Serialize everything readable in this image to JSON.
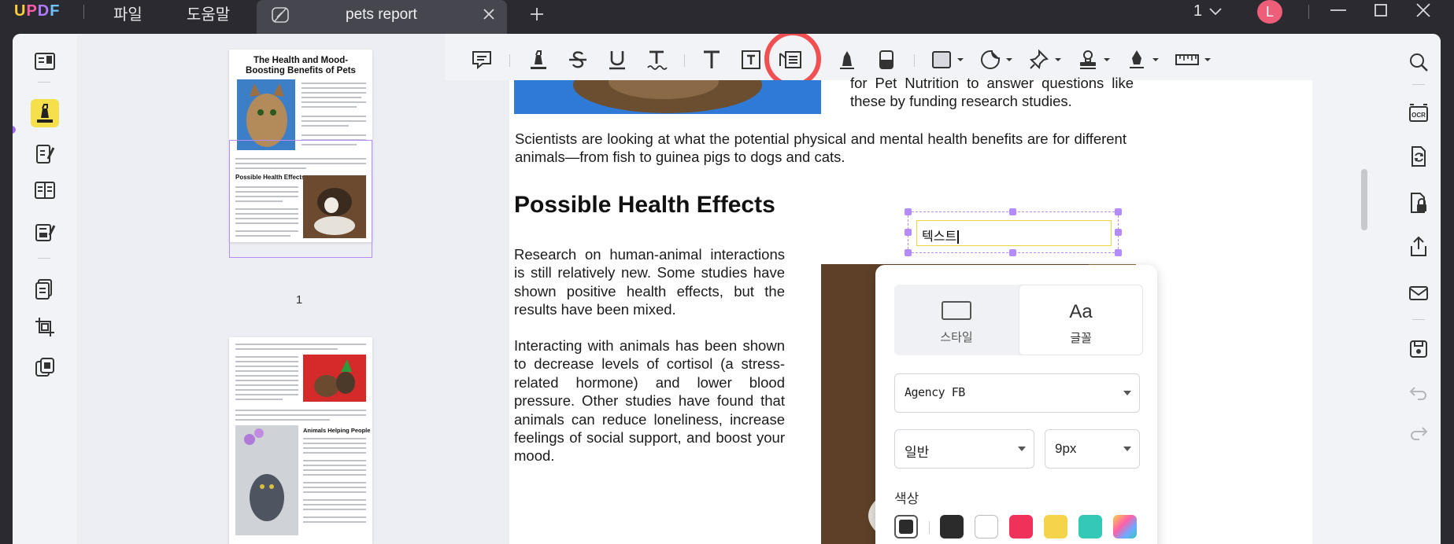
{
  "app": {
    "logo": "UPDF",
    "menu_file": "파일",
    "menu_help": "도움말",
    "tab_title": "pets report",
    "page_counter": "1",
    "avatar_initial": "L"
  },
  "thumbnails": {
    "page1_title": "The Health and Mood-Boosting Benefits of Pets",
    "page1_heading": "Possible Health Effects",
    "page1_number": "1",
    "page2_heading": "Animals Helping People"
  },
  "document": {
    "top_right_text": "for Pet Nutrition to answer questions like these by funding research studies.",
    "intro": "Scientists are looking at what the potential physical and mental health benefits are for different animals—from fish to guinea pigs to dogs and cats.",
    "heading": "Possible Health Effects",
    "para1": "Research on human-animal interactions is still relatively new. Some studies have shown positive health effects, but the results have been mixed.",
    "para2": "Interacting with animals has been shown to decrease levels of cortisol (a stress-related hormone) and lower blood pressure. Other studies have found that animals can reduce loneliness, increase feelings of social support, and boost your mood."
  },
  "textbox": {
    "value": "텍스트"
  },
  "panel": {
    "tab_style": "스타일",
    "tab_font": "글꼴",
    "tab_font_icon": "Aa",
    "font_family": "Agency FB",
    "font_weight": "일반",
    "font_size": "9px",
    "color_label": "색상",
    "swatches": [
      "#2b2b2b",
      "#2b2b2b",
      "#ffffff",
      "#f0325a",
      "#f5d34a",
      "#34c9b6",
      "gradient"
    ]
  },
  "colors": {
    "accent": "#b58cff",
    "highlight_ring": "#f24f52",
    "titlebar": "#2a2a30"
  }
}
